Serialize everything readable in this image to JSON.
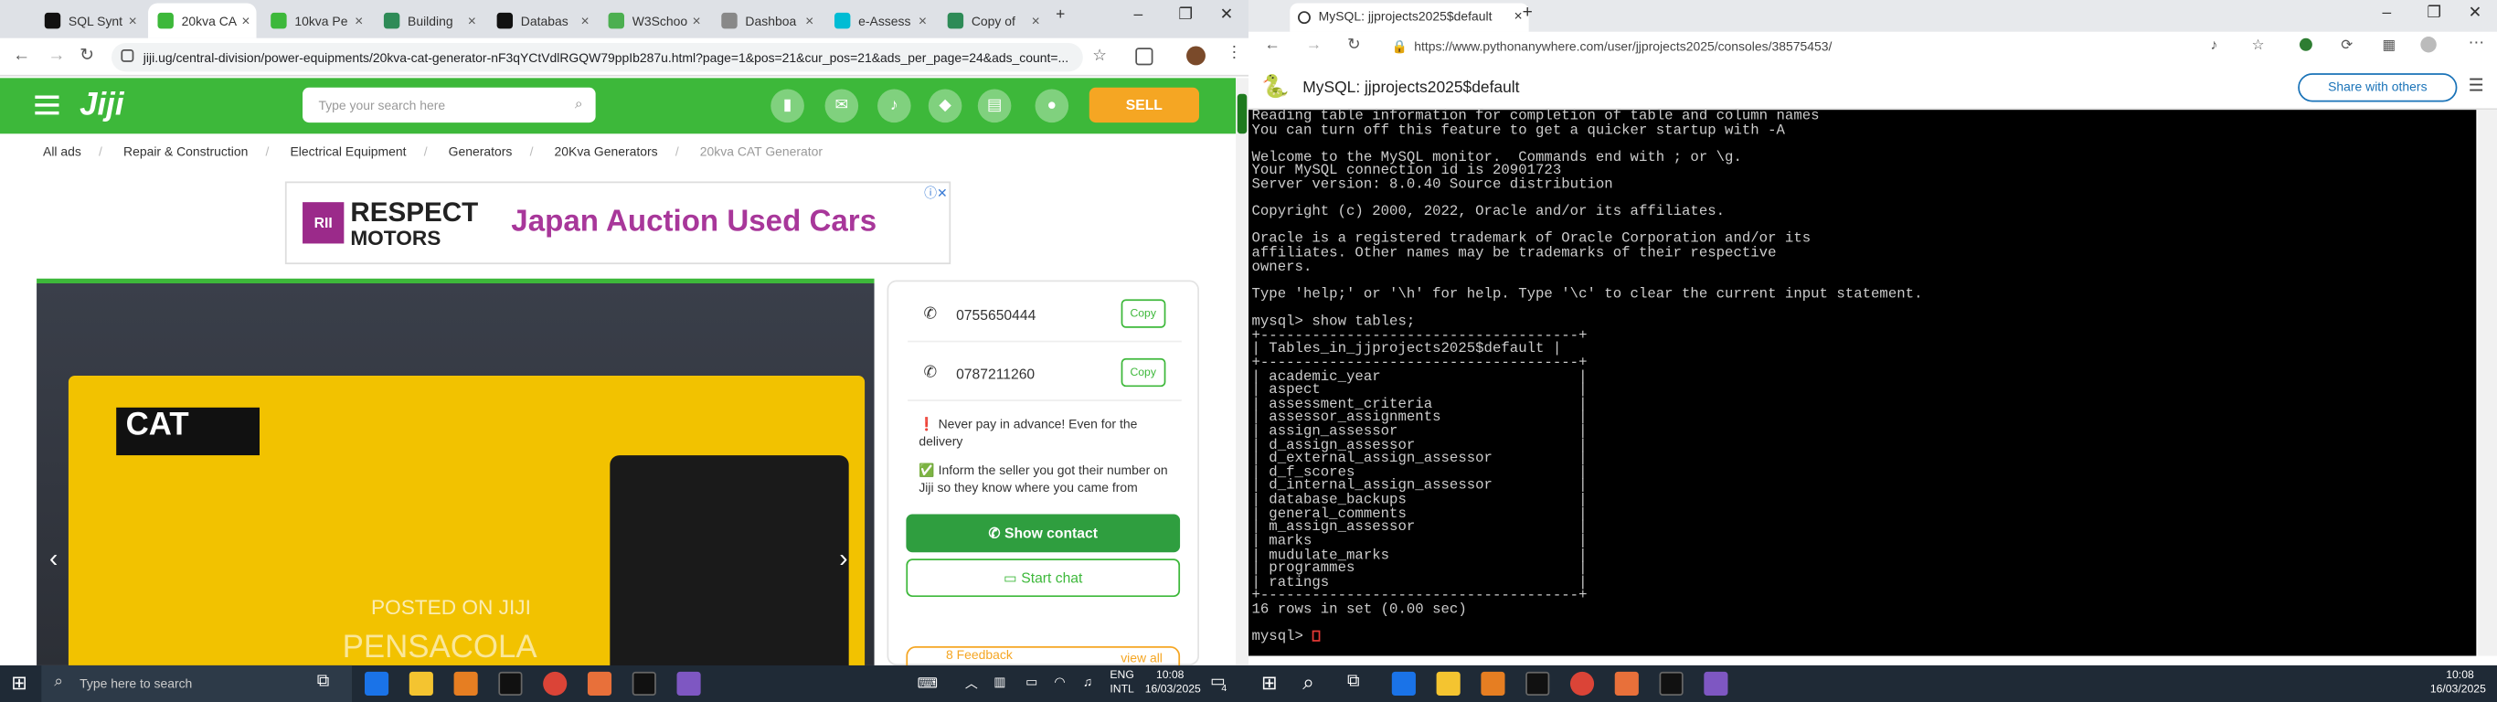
{
  "left_browser": {
    "tabs": [
      {
        "label": "SQL Synt",
        "color": "#111111"
      },
      {
        "label": "20kva CA",
        "color": "#3db83a"
      },
      {
        "label": "10kva Pe",
        "color": "#3db83a"
      },
      {
        "label": "Building",
        "color": "#2e8b57"
      },
      {
        "label": "Databas",
        "color": "#111111"
      },
      {
        "label": "W3Schoo",
        "color": "#4caf50"
      },
      {
        "label": "Dashboa",
        "color": "#888888"
      },
      {
        "label": "e-Assess",
        "color": "#00bcd4"
      },
      {
        "label": "Copy of",
        "color": "#2e8b57"
      }
    ],
    "close_glyph": "×",
    "new_tab_glyph": "+",
    "window_controls": [
      "–",
      "❐",
      "✕"
    ],
    "url": "jiji.ug/central-division/power-equipments/20kva-cat-generator-nF3qYCtVdlRGQW79ppIb287u.html?page=1&pos=21&cur_pos=21&ads_per_page=24&ads_count=...",
    "nav": {
      "back": "←",
      "forward": "→",
      "reload": "↻"
    }
  },
  "jiji": {
    "logo": "Jiji",
    "search_placeholder": "Type your search here",
    "sell_label": "SELL",
    "breadcrumbs": [
      "All ads",
      "Repair & Construction",
      "Electrical Equipment",
      "Generators",
      "20Kva Generators",
      "20kva CAT Generator"
    ],
    "ad": {
      "brand_mark": "RII",
      "brand_line1": "RESPECT",
      "brand_line2": "MOTORS",
      "headline": "Japan Auction Used Cars",
      "brand_color": "#9b2a8a"
    },
    "photo": {
      "brand": "CAT",
      "watermark": "POSTED ON JIJI",
      "watermark2": "PENSACOLA"
    },
    "phones": [
      {
        "number": "0755650444",
        "copy": "Copy"
      },
      {
        "number": "0787211260",
        "copy": "Copy"
      }
    ],
    "tips": [
      {
        "icon": "❗",
        "text": "Never pay in advance! Even for the delivery"
      },
      {
        "icon": "✅",
        "text": "Inform the seller you got their number on Jiji so they know where you came from"
      }
    ],
    "show_contact": "Show contact",
    "start_chat": "Start chat",
    "feedback": "8 Feedback",
    "view_all": "view all",
    "accent": "#3db83a"
  },
  "right_browser": {
    "tab_label": "MySQL: jjprojects2025$default",
    "url": "https://www.pythonanywhere.com/user/jjprojects2025/consoles/38575453/",
    "console_title": "MySQL: jjprojects2025$default",
    "share_label": "Share with others",
    "terminal_lines": [
      "Reading table information for completion of table and column names",
      "You can turn off this feature to get a quicker startup with -A",
      "",
      "Welcome to the MySQL monitor.  Commands end with ; or \\g.",
      "Your MySQL connection id is 20901723",
      "Server version: 8.0.40 Source distribution",
      "",
      "Copyright (c) 2000, 2022, Oracle and/or its affiliates.",
      "",
      "Oracle is a registered trademark of Oracle Corporation and/or its",
      "affiliates. Other names may be trademarks of their respective",
      "owners.",
      "",
      "Type 'help;' or '\\h' for help. Type '\\c' to clear the current input statement.",
      "",
      "mysql> show tables;",
      "+-------------------------------------+",
      "| Tables_in_jjprojects2025$default |",
      "+-------------------------------------+",
      "| academic_year                       |",
      "| aspect                              |",
      "| assessment_criteria                 |",
      "| assessor_assignments                |",
      "| assign_assessor                     |",
      "| d_assign_assessor                   |",
      "| d_external_assign_assessor          |",
      "| d_f_scores                          |",
      "| d_internal_assign_assessor          |",
      "| database_backups                    |",
      "| general_comments                    |",
      "| m_assign_assessor                   |",
      "| marks                               |",
      "| mudulate_marks                      |",
      "| programmes                          |",
      "| ratings                             |",
      "+-------------------------------------+",
      "16 rows in set (0.00 sec)",
      "",
      "mysql> "
    ]
  },
  "taskbar": {
    "search_placeholder": "Type here to search",
    "lang1": "ENG",
    "lang2": "INTL",
    "time_left": "10:08",
    "date_left": "16/03/2025",
    "time_right": "10:08",
    "date_right": "16/03/2025",
    "notifications": "4"
  }
}
